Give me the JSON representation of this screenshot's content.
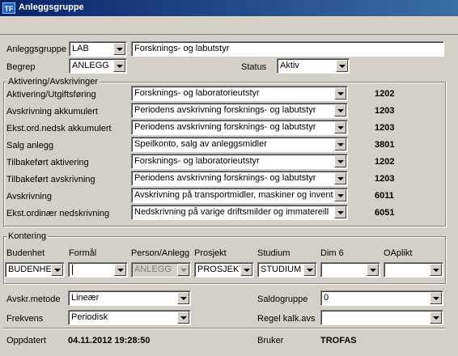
{
  "window": {
    "icon": "TF",
    "title": "Anleggsgruppe"
  },
  "header": {
    "anleggsgruppe_label": "Anleggsgruppe",
    "anleggsgruppe_value": "LAB",
    "anleggsgruppe_description": "Forsknings- og labutstyr",
    "begrep_label": "Begrep",
    "begrep_value": "ANLEGG",
    "status_label": "Status",
    "status_value": "Aktiv"
  },
  "aktivering": {
    "legend": "Aktivering/Avskrivinger",
    "rows": [
      {
        "label": "Aktivering/Utgiftsføring",
        "value": "Forsknings- og laboratorieutstyr",
        "code": "1202"
      },
      {
        "label": "Avskrivning akkumulert",
        "value": "Periodens avskrivning forsknings- og labutstyr",
        "code": "1203"
      },
      {
        "label": "Ekst.ord.nedsk akkumulert",
        "value": "Periodens avskrivning forsknings- og labutstyr",
        "code": "1203"
      },
      {
        "label": "Salg anlegg",
        "value": "Speilkonto, salg av anleggsmidler",
        "code": "3801"
      },
      {
        "label": "Tilbakeført aktivering",
        "value": "Forsknings- og laboratorieutstyr",
        "code": "1202"
      },
      {
        "label": "Tilbakeført avskrivning",
        "value": "Periodens avskrivning forsknings- og labutstyr",
        "code": "1203"
      },
      {
        "label": "Avskrivning",
        "value": "Avskrivning på transportmidler, maskiner og invent",
        "code": "6011"
      },
      {
        "label": "Ekst.ordinær nedskrivning",
        "value": "Nedskrivning på varige driftsmilder og immatereill",
        "code": "6051"
      }
    ]
  },
  "kontering": {
    "legend": "Kontering",
    "columns": [
      {
        "label": "Budenhet",
        "value": "BUDENHET"
      },
      {
        "label": "Formål",
        "value": ""
      },
      {
        "label": "Person/Anlegg",
        "value": "ANLEGG"
      },
      {
        "label": "Prosjekt",
        "value": "PROSJEKT"
      },
      {
        "label": "Studium",
        "value": "STUDIUM"
      },
      {
        "label": "Dim 6",
        "value": ""
      },
      {
        "label": "OAplikt",
        "value": ""
      }
    ]
  },
  "settings": {
    "avskr_metode_label": "Avskr.metode",
    "avskr_metode_value": "Lineær",
    "frekvens_label": "Frekvens",
    "frekvens_value": "Periodisk",
    "saldogruppe_label": "Saldogruppe",
    "saldogruppe_value": "0",
    "regel_label": "Regel kalk.avs",
    "regel_value": ""
  },
  "footer": {
    "oppdatert_label": "Oppdatert",
    "oppdatert_value": "04.11.2012 19:28:50",
    "bruker_label": "Bruker",
    "bruker_value": "TROFAS"
  }
}
